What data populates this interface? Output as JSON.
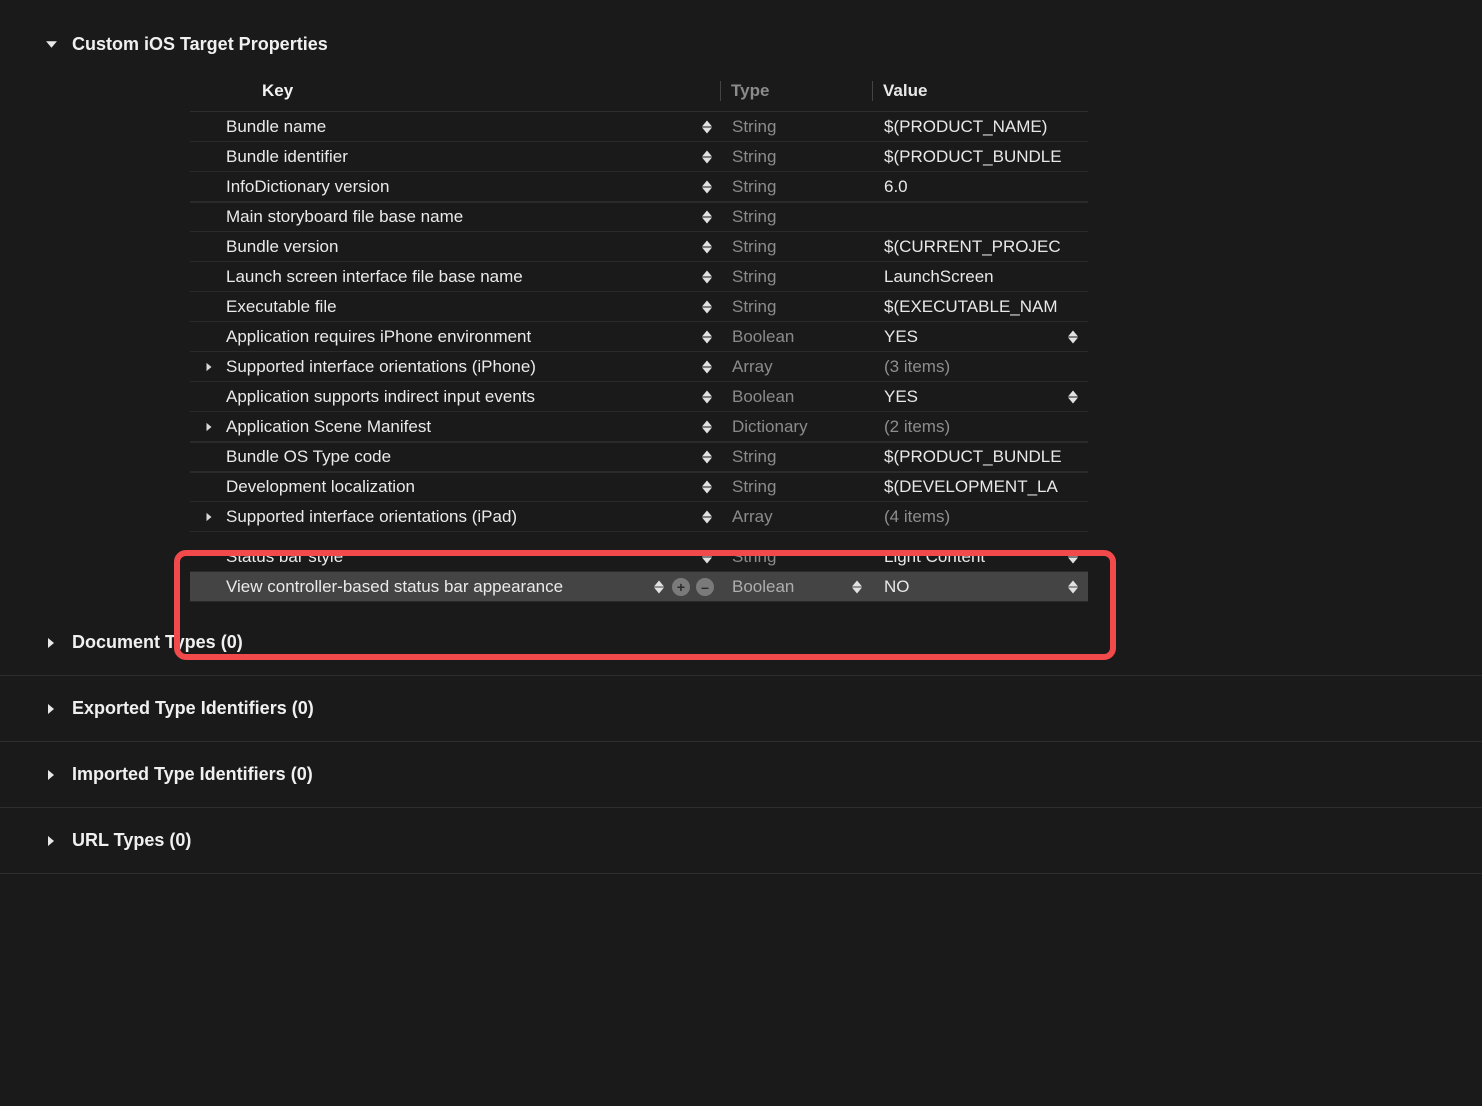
{
  "sections": {
    "main": {
      "title": "Custom iOS Target Properties",
      "expanded": true
    },
    "doc": {
      "title": "Document Types (0)",
      "expanded": false
    },
    "exp": {
      "title": "Exported Type Identifiers (0)",
      "expanded": false
    },
    "imp": {
      "title": "Imported Type Identifiers (0)",
      "expanded": false
    },
    "url": {
      "title": "URL Types (0)",
      "expanded": false
    }
  },
  "columns": {
    "key": "Key",
    "type": "Type",
    "value": "Value"
  },
  "rows": [
    {
      "key": "Bundle name",
      "type": "String",
      "value": "$(PRODUCT_NAME)"
    },
    {
      "key": "Bundle identifier",
      "type": "String",
      "value": "$(PRODUCT_BUNDLE"
    },
    {
      "key": "InfoDictionary version",
      "type": "String",
      "value": "6.0"
    },
    {
      "key": "Main storyboard file base name",
      "type": "String",
      "value": ""
    },
    {
      "key": "Bundle version",
      "type": "String",
      "value": "$(CURRENT_PROJEC"
    },
    {
      "key": "Launch screen interface file base name",
      "type": "String",
      "value": "LaunchScreen"
    },
    {
      "key": "Executable file",
      "type": "String",
      "value": "$(EXECUTABLE_NAM"
    },
    {
      "key": "Application requires iPhone environment",
      "type": "Boolean",
      "value": "YES",
      "bool": true
    },
    {
      "key": "Supported interface orientations (iPhone)",
      "type": "Array",
      "value": "(3 items)",
      "disclosure": true
    },
    {
      "key": "Application supports indirect input events",
      "type": "Boolean",
      "value": "YES",
      "bool": true
    },
    {
      "key": "Application Scene Manifest",
      "type": "Dictionary",
      "value": "(2 items)",
      "disclosure": true
    },
    {
      "key": "Bundle OS Type code",
      "type": "String",
      "value": "$(PRODUCT_BUNDLE"
    },
    {
      "key": "Development localization",
      "type": "String",
      "value": "$(DEVELOPMENT_LA"
    },
    {
      "key": "Supported interface orientations (iPad)",
      "type": "Array",
      "value": "(4 items)",
      "disclosure": true
    },
    {
      "key": "Status bar style",
      "type": "String",
      "value": "Light Content",
      "bool": true
    },
    {
      "key": "View controller-based status bar appearance",
      "type": "Boolean",
      "value": "NO",
      "bool": true,
      "selected": true,
      "editing": true
    }
  ]
}
